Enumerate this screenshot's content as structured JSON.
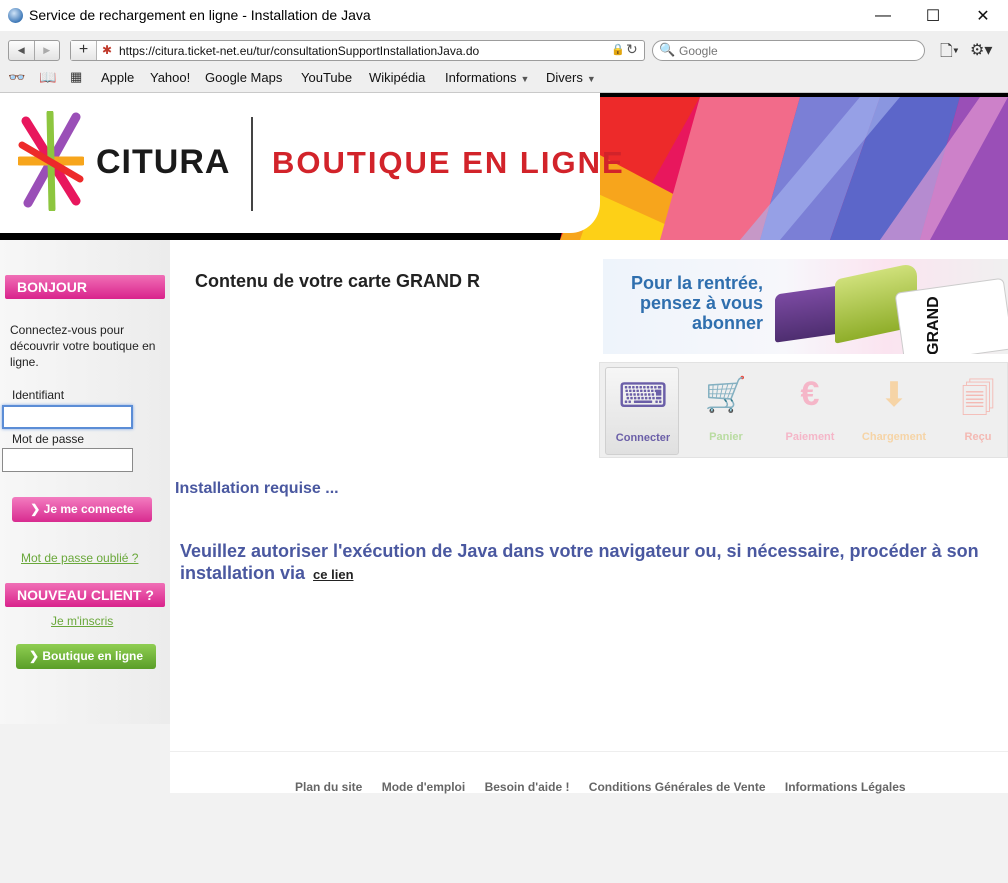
{
  "window": {
    "title": "Service de rechargement en ligne - Installation de Java",
    "minimize": "—",
    "maximize": "☐",
    "close": "✕"
  },
  "toolbar": {
    "url": "https://citura.ticket-net.eu/tur/consultationSupportInstallationJava.do",
    "search_placeholder": "Google",
    "bookmarks": [
      "Apple",
      "Yahoo!",
      "Google Maps",
      "YouTube",
      "Wikipédia",
      "Informations",
      "Divers"
    ]
  },
  "banner": {
    "logo_text": "CITURA",
    "tagline": "BOUTIQUE EN LIGNE"
  },
  "sidebar": {
    "bonjour": "BONJOUR",
    "intro": "Connectez-vous pour découvrir votre boutique en ligne.",
    "id_label": "Identifiant",
    "id_value": "",
    "pwd_label": "Mot de passe",
    "pwd_value": "",
    "login_button": "❯ Je me connecte",
    "forgot_link": "Mot de passe oublié ?",
    "new_client": "NOUVEAU CLIENT ?",
    "signup_link": "Je m'inscris",
    "shop_button": "❯ Boutique en ligne"
  },
  "main": {
    "card_title": "Contenu de votre carte GRAND R",
    "promo_text": "Pour la rentrée, pensez à vous abonner",
    "promo_card_label": "GRAND",
    "steps": [
      {
        "label": "Connecter",
        "icon": "usb-key-icon",
        "color": "#6b5fa8",
        "active": true
      },
      {
        "label": "Panier",
        "icon": "cart-icon",
        "color": "#b9dca1",
        "active": false
      },
      {
        "label": "Paiement",
        "icon": "euro-icon",
        "color": "#f5b6c8",
        "active": false
      },
      {
        "label": "Chargement",
        "icon": "download-icon",
        "color": "#f6d4a6",
        "active": false
      },
      {
        "label": "Reçu",
        "icon": "receipt-icon",
        "color": "#f4b9b3",
        "active": false
      }
    ],
    "install_required": "Installation requise ...",
    "java_message": "Veuillez autoriser l'exécution de Java dans votre navigateur ou, si nécessaire, procéder à son installation via",
    "java_link": "ce lien"
  },
  "footer": {
    "links": [
      "Plan du site",
      "Mode d'emploi",
      "Besoin d'aide !",
      "Conditions Générales de Vente",
      "Informations Légales"
    ]
  }
}
